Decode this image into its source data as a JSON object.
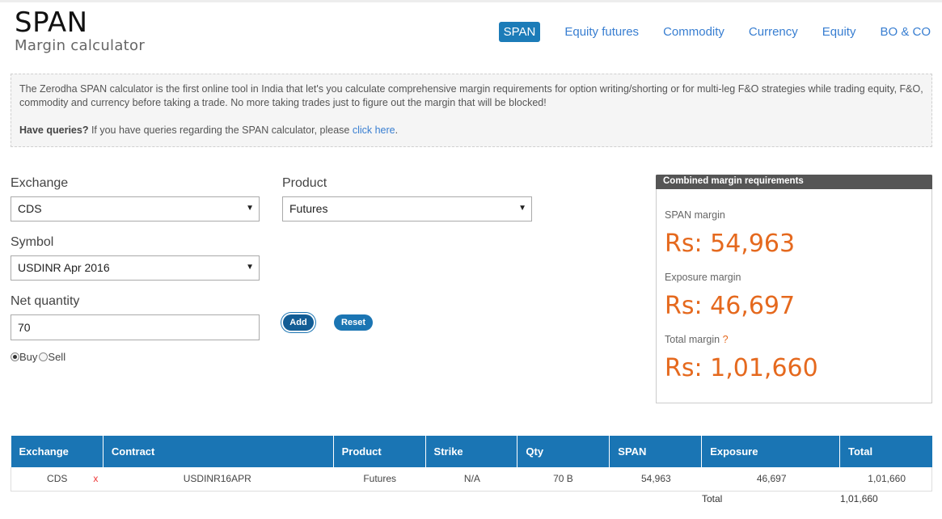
{
  "brand": {
    "title": "SPAN",
    "subtitle": "Margin calculator"
  },
  "nav": [
    {
      "label": "SPAN",
      "active": true
    },
    {
      "label": "Equity futures"
    },
    {
      "label": "Commodity"
    },
    {
      "label": "Currency"
    },
    {
      "label": "Equity"
    },
    {
      "label": "BO & CO"
    }
  ],
  "info": {
    "text": "The Zerodha SPAN calculator is the first online tool in India that let's you calculate comprehensive margin requirements for option writing/shorting or for multi-leg F&O strategies while trading equity, F&O, commodity and currency before taking a trade. No more taking trades just to figure out the margin that will be blocked!",
    "queries_label": "Have queries?",
    "queries_text": " If you have queries regarding the SPAN calculator, please ",
    "link": "click here",
    "end": "."
  },
  "form": {
    "exchange_label": "Exchange",
    "exchange_value": "CDS",
    "product_label": "Product",
    "product_value": "Futures",
    "symbol_label": "Symbol",
    "symbol_value": "USDINR Apr 2016",
    "qty_label": "Net quantity",
    "qty_value": "70",
    "add_label": "Add",
    "reset_label": "Reset",
    "buy_label": "Buy",
    "sell_label": "Sell",
    "side": "Buy",
    "caret": "▼"
  },
  "margins": {
    "header": "Combined margin requirements",
    "span_label": "SPAN margin",
    "span_value": "Rs: 54,963",
    "exposure_label": "Exposure margin",
    "exposure_value": "Rs: 46,697",
    "total_label": "Total margin",
    "total_help": "?",
    "total_value": "Rs: 1,01,660"
  },
  "table": {
    "headers": [
      "Exchange",
      "Contract",
      "Product",
      "Strike",
      "Qty",
      "SPAN",
      "Exposure",
      "Total"
    ],
    "rows": [
      {
        "exchange": "CDS",
        "remove": "x",
        "contract": "USDINR16APR",
        "product": "Futures",
        "strike": "N/A",
        "qty": "70 B",
        "span": "54,963",
        "exposure": "46,697",
        "total": "1,01,660"
      }
    ],
    "total_label": "Total",
    "total_value": "1,01,660"
  },
  "colors": {
    "accent": "#1a75b4",
    "margin_value": "#e5691e",
    "link": "#387ed1"
  }
}
